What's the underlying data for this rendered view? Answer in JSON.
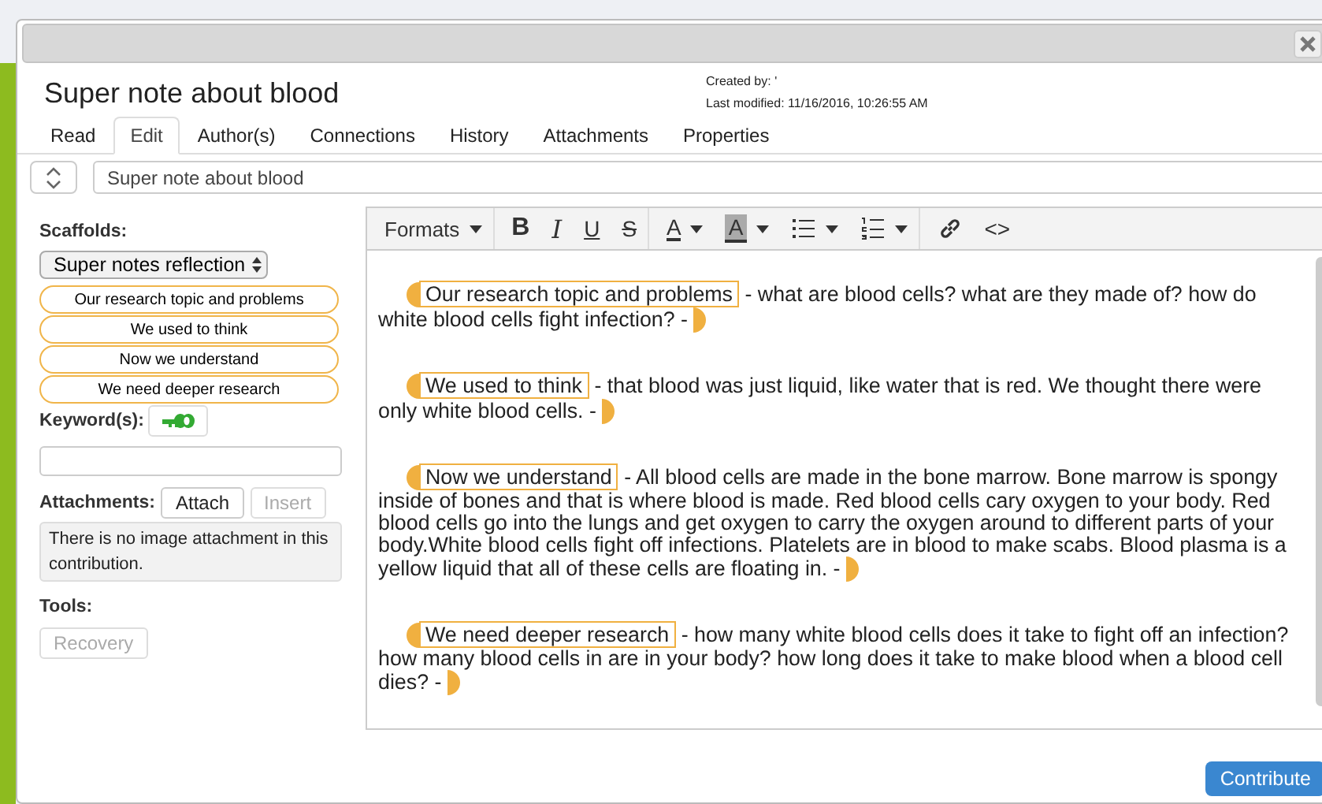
{
  "note": {
    "title": "Super note about blood",
    "created_by": "Created by: '",
    "last_modified": "Last modified: 11/16/2016, 10:26:55 AM"
  },
  "tabs": [
    {
      "label": "Read",
      "selected": false
    },
    {
      "label": "Edit",
      "selected": true
    },
    {
      "label": "Author(s)",
      "selected": false
    },
    {
      "label": "Connections",
      "selected": false
    },
    {
      "label": "History",
      "selected": false
    },
    {
      "label": "Attachments",
      "selected": false
    },
    {
      "label": "Properties",
      "selected": false
    }
  ],
  "title_field": {
    "value": "Super note about blood"
  },
  "scaffolds": {
    "label": "Scaffolds:",
    "select": "Super notes reflection",
    "items": [
      "Our research topic and problems",
      "We used to think",
      "Now we understand",
      "We need deeper research"
    ]
  },
  "keywords": {
    "label": "Keyword(s):"
  },
  "attachments": {
    "label": "Attachments:",
    "buttons": [
      {
        "label": "Attach",
        "disabled": false
      },
      {
        "label": "Insert",
        "disabled": true
      }
    ],
    "message": "There is no image attachment in this contribution."
  },
  "tools": {
    "label": "Tools:",
    "buttons": [
      {
        "label": "Recovery",
        "disabled": true
      }
    ]
  },
  "toolbar": [
    {
      "kind": "formats",
      "label": "Formats",
      "dropdown": true,
      "group_end": true
    },
    {
      "kind": "bold",
      "label": "B",
      "dropdown": false,
      "group_end": false
    },
    {
      "kind": "italic",
      "label": "I",
      "dropdown": false,
      "group_end": false
    },
    {
      "kind": "underline",
      "label": "U",
      "dropdown": false,
      "group_end": false
    },
    {
      "kind": "strike",
      "label": "S",
      "dropdown": false,
      "group_end": true
    },
    {
      "kind": "forecolor",
      "label": "A",
      "dropdown": true,
      "group_end": false
    },
    {
      "kind": "backcolor",
      "label": "A",
      "dropdown": true,
      "group_end": false
    },
    {
      "kind": "bullist",
      "dropdown": true,
      "group_end": false
    },
    {
      "kind": "numlist",
      "dropdown": true,
      "group_end": true
    },
    {
      "kind": "link",
      "dropdown": false,
      "group_end": false
    },
    {
      "kind": "code",
      "label": "<>",
      "dropdown": false,
      "group_end": false
    }
  ],
  "paragraphs": [
    {
      "scaffold": "Our research topic and problems",
      "text": " - what are blood cells?  what are they made of? how do white blood cells fight infection? - "
    },
    {
      "scaffold": "We used to think",
      "text": " - that blood was just liquid, like water that is red.  We thought there were only white blood cells.  - "
    },
    {
      "scaffold": "Now we understand",
      "text": " - All blood cells are made  in the bone marrow.  Bone marrow is spongy inside of bones and that is where blood is made.  Red blood cells cary oxygen to your body.  Red blood cells go into the lungs and get oxygen to carry the oxygen around to different parts of your body.White blood cells fight off infections. Platelets are in blood to make scabs.  Blood plasma is a yellow liquid that all of these cells are floating in. - "
    },
    {
      "scaffold": "We need deeper research",
      "text": " - how many white blood cells does it take to fight off an infection?  how many blood cells in are in your body?  how long does it take to make blood when a blood cell dies? - "
    }
  ],
  "contribute": "Contribute"
}
